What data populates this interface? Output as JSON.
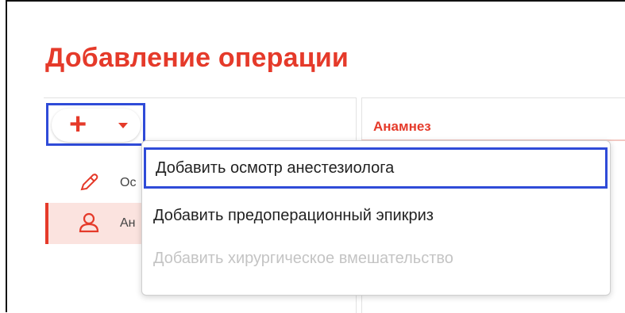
{
  "page": {
    "title": "Добавление операции"
  },
  "toolbar": {
    "add_symbol": "+"
  },
  "sidebar": {
    "items": [
      {
        "label": "Ос",
        "icon": "pencil-icon"
      },
      {
        "label": "Ан",
        "icon": "user-icon"
      }
    ]
  },
  "content": {
    "tab_label": "Анамнез"
  },
  "dropdown": {
    "items": [
      {
        "label": "Добавить осмотр анестезиолога",
        "enabled": true
      },
      {
        "label": "Добавить предоперационный эпикриз",
        "enabled": true
      },
      {
        "label": "Добавить хирургическое вмешательство",
        "enabled": false
      }
    ]
  },
  "colors": {
    "accent": "#e53a2a",
    "highlight": "#2f4bd8",
    "disabled": "#c4c4c4"
  }
}
